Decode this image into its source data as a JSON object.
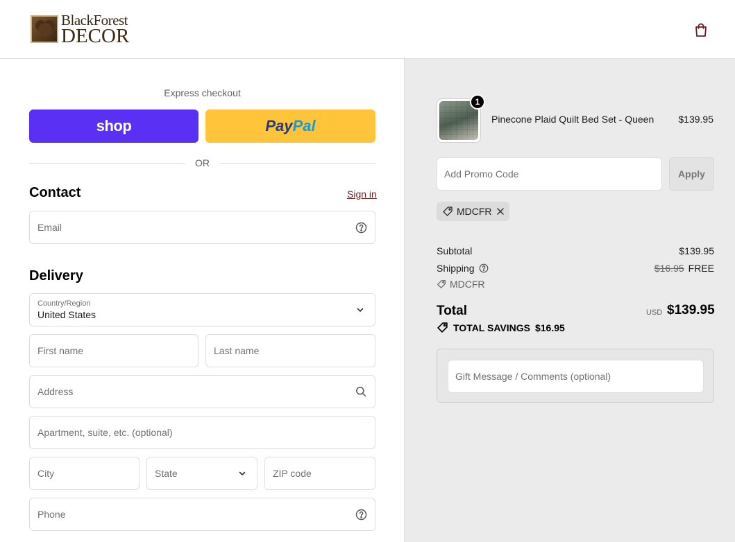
{
  "brand": {
    "line1": "BlackForest",
    "line2": "DECOR"
  },
  "header": {
    "cart_icon": "shopping-bag-icon"
  },
  "express": {
    "title": "Express checkout",
    "shop_label": "shop",
    "paypal_pay": "Pay",
    "paypal_pal": "Pal",
    "or_label": "OR"
  },
  "contact": {
    "title": "Contact",
    "sign_in": "Sign in",
    "email_placeholder": "Email"
  },
  "delivery": {
    "title": "Delivery",
    "country_label": "Country/Region",
    "country_value": "United States",
    "first_name_placeholder": "First name",
    "last_name_placeholder": "Last name",
    "address_placeholder": "Address",
    "apartment_placeholder": "Apartment, suite, etc. (optional)",
    "city_placeholder": "City",
    "state_placeholder": "State",
    "zip_placeholder": "ZIP code",
    "phone_placeholder": "Phone"
  },
  "order": {
    "item": {
      "name": "Pinecone Plaid Quilt Bed Set - Queen",
      "price": "$139.95",
      "quantity": "1"
    },
    "promo_placeholder": "Add Promo Code",
    "apply_label": "Apply",
    "applied_code": "MDCFR",
    "subtotal_label": "Subtotal",
    "subtotal_value": "$139.95",
    "shipping_label": "Shipping",
    "shipping_original": "$16.95",
    "shipping_value": "FREE",
    "discount_code": "MDCFR",
    "total_label": "Total",
    "currency": "USD",
    "total_value": "$139.95",
    "savings_label": "TOTAL SAVINGS",
    "savings_value": "$16.95",
    "gift_placeholder": "Gift Message / Comments (optional)"
  },
  "colors": {
    "shop_purple": "#5a31f4",
    "paypal_yellow": "#ffc439",
    "sign_in_link": "#6b1e1e",
    "summary_bg": "#ebebeb"
  }
}
